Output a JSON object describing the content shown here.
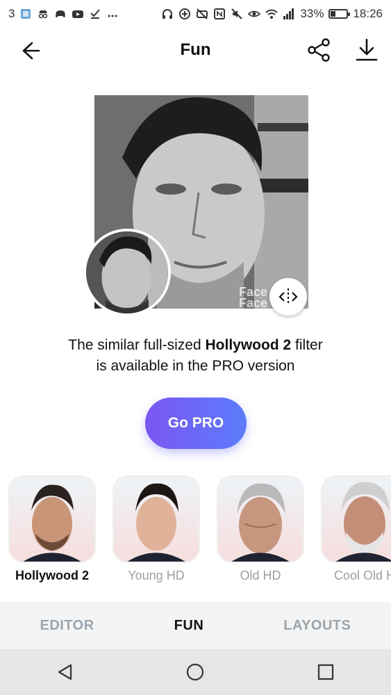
{
  "status_bar": {
    "notification_count": "3",
    "battery_percent": "33%",
    "battery_level": 0.33,
    "time": "18:26",
    "left_icons": [
      "image-icon",
      "incognito-icon",
      "game-icon",
      "youtube-icon",
      "check-icon",
      "more-icon"
    ],
    "right_icons": [
      "headphones-icon",
      "data-saver-icon",
      "do-not-disturb-icon",
      "nfc-icon",
      "mute-icon",
      "eye-icon",
      "wifi-icon",
      "signal-icon",
      "battery-icon"
    ]
  },
  "header": {
    "title": "Fun",
    "back_icon": "arrow-left-icon",
    "share_icon": "share-icon",
    "download_icon": "download-icon"
  },
  "preview": {
    "watermark": "Face\nFace",
    "handle_icon": "compare-handle-icon"
  },
  "message": {
    "line1_before": "The similar full-sized ",
    "filter_name": "Hollywood 2",
    "line1_after": " filter",
    "line2": "is available in the PRO version"
  },
  "cta": {
    "label": "Go PRO"
  },
  "filters": [
    {
      "label": "Hollywood 2",
      "active": true
    },
    {
      "label": "Young HD",
      "active": false
    },
    {
      "label": "Old HD",
      "active": false
    },
    {
      "label": "Cool Old H",
      "active": false
    }
  ],
  "tabs": [
    {
      "label": "EDITOR",
      "active": false
    },
    {
      "label": "FUN",
      "active": true
    },
    {
      "label": "LAYOUTS",
      "active": false
    }
  ],
  "nav": {
    "back_icon": "triangle-back-icon",
    "home_icon": "circle-home-icon",
    "recents_icon": "square-recents-icon"
  },
  "colors": {
    "accent_start": "#7b56f3",
    "accent_end": "#5c7cfb",
    "tab_inactive": "#9aa4ad",
    "label_inactive": "#9aa0a6"
  }
}
